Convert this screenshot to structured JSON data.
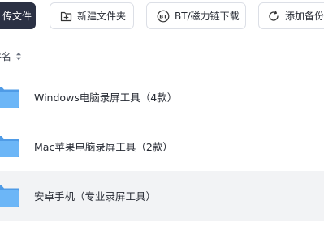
{
  "toolbar": {
    "upload_label": "传文件",
    "new_folder_label": "新建文件夹",
    "bt_label": "BT/磁力链下载",
    "add_backup_label": "添加备份"
  },
  "file_list": {
    "column_name": "件名",
    "items": [
      {
        "label": "Windows电脑录屏工具（4款）",
        "icon": "folder-icon"
      },
      {
        "label": "Mac苹果电脑录屏工具（2款）",
        "icon": "folder-icon"
      },
      {
        "label": "安卓手机（专业录屏工具）",
        "icon": "folder-icon"
      }
    ]
  },
  "colors": {
    "primary_button": "#2b3144",
    "folder": "#64b5f6",
    "selected_row": "#f2f3f5"
  }
}
